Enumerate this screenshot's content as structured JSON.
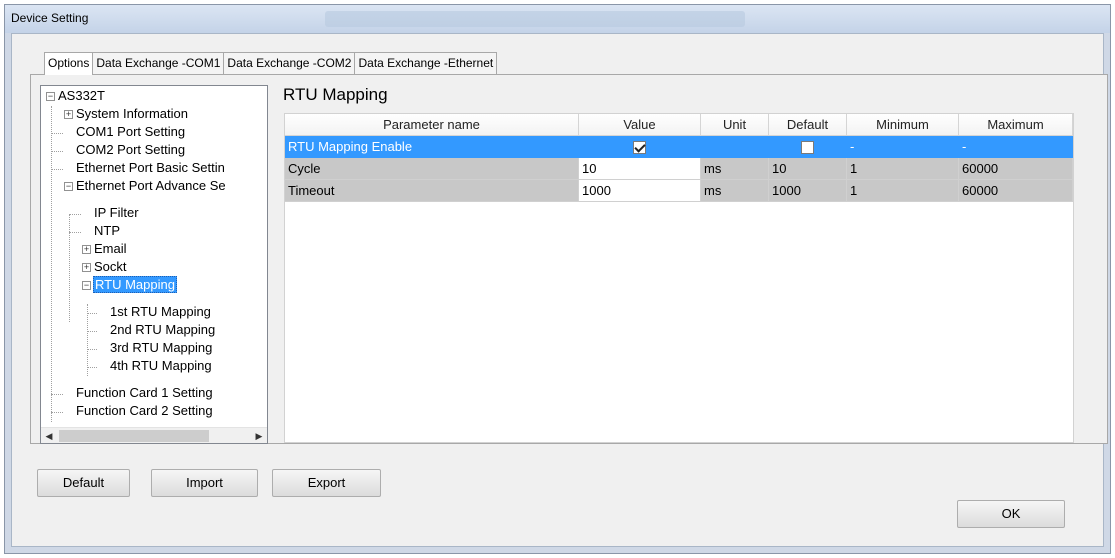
{
  "window": {
    "title": "Device Setting"
  },
  "tabs": [
    "Options",
    "Data Exchange -COM1",
    "Data Exchange -COM2",
    "Data Exchange -Ethernet"
  ],
  "active_tab": 0,
  "tree": {
    "items": [
      {
        "label": "AS332T"
      },
      {
        "label": "System Information"
      },
      {
        "label": "COM1 Port Setting"
      },
      {
        "label": "COM2 Port Setting"
      },
      {
        "label": "Ethernet Port Basic Settin"
      },
      {
        "label": "Ethernet Port Advance Se"
      },
      {
        "label": "IP Filter"
      },
      {
        "label": "NTP"
      },
      {
        "label": "Email"
      },
      {
        "label": "Sockt"
      },
      {
        "label": "RTU Mapping"
      },
      {
        "label": "1st RTU Mapping"
      },
      {
        "label": "2nd RTU Mapping"
      },
      {
        "label": "3rd RTU Mapping"
      },
      {
        "label": "4th RTU Mapping"
      },
      {
        "label": "Function Card 1 Setting"
      },
      {
        "label": "Function Card 2 Setting"
      }
    ],
    "selected": "RTU Mapping"
  },
  "panel": {
    "title": "RTU Mapping"
  },
  "grid": {
    "columns": [
      "Parameter name",
      "Value",
      "Unit",
      "Default",
      "Minimum",
      "Maximum"
    ],
    "rows": [
      {
        "name": "RTU Mapping Enable",
        "value": "",
        "value_checked": true,
        "unit": "",
        "default": "",
        "default_checked": false,
        "minimum": "-",
        "maximum": "-"
      },
      {
        "name": "Cycle",
        "value": "10",
        "unit": "ms",
        "default": "10",
        "minimum": "1",
        "maximum": "60000"
      },
      {
        "name": "Timeout",
        "value": "1000",
        "unit": "ms",
        "default": "1000",
        "minimum": "1",
        "maximum": "60000"
      }
    ]
  },
  "buttons": {
    "default": "Default",
    "import": "Import",
    "export": "Export",
    "ok": "OK"
  },
  "colors": {
    "selection": "#3399ff",
    "title_bar": "#c4d3e8"
  }
}
